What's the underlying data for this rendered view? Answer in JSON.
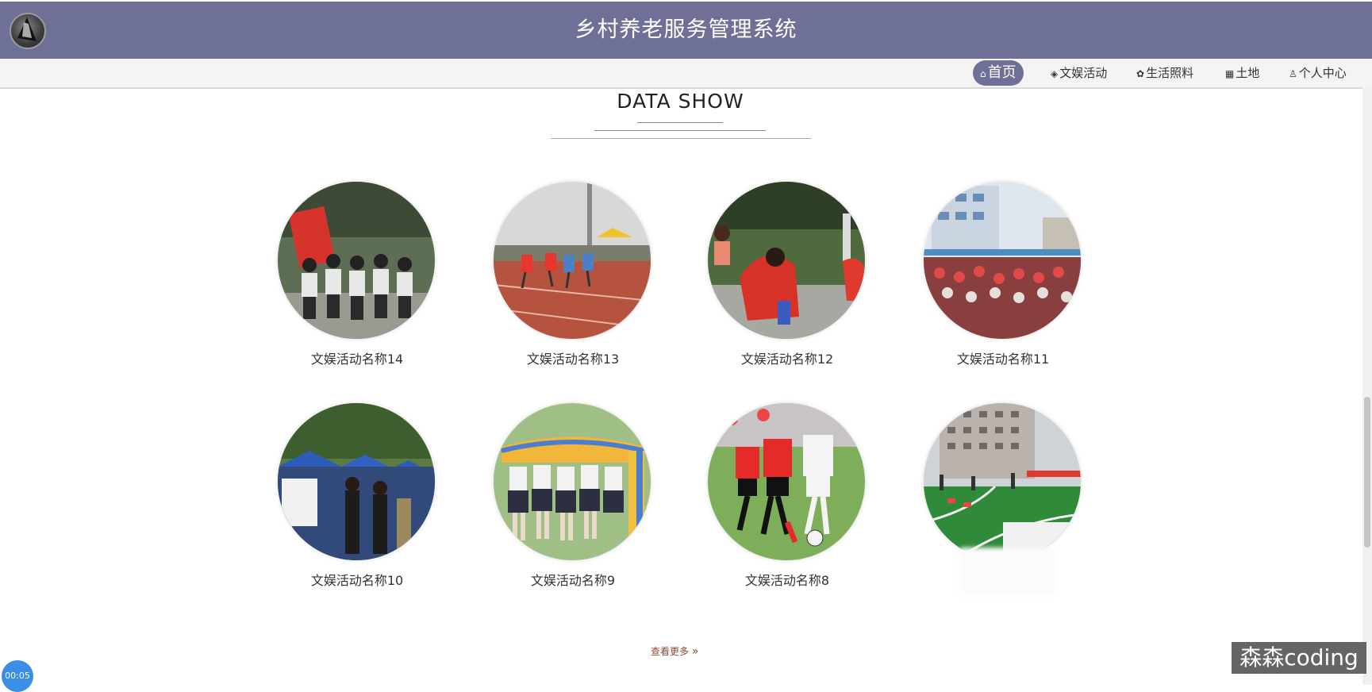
{
  "header": {
    "title": "乡村养老服务管理系统"
  },
  "nav": {
    "items": [
      {
        "label": "首页",
        "icon": "home-icon",
        "glyph": "⌂",
        "active": true
      },
      {
        "label": "文娱活动",
        "icon": "layers-icon",
        "glyph": "◈",
        "active": false
      },
      {
        "label": "生活照料",
        "icon": "palette-icon",
        "glyph": "✿",
        "active": false
      },
      {
        "label": "土地",
        "icon": "grid-icon",
        "glyph": "▦",
        "active": false
      },
      {
        "label": "个人中心",
        "icon": "user-icon",
        "glyph": "♙",
        "active": false
      }
    ]
  },
  "section": {
    "title": "DATA SHOW"
  },
  "activities": [
    {
      "name": "文娱活动名称14"
    },
    {
      "name": "文娱活动名称13"
    },
    {
      "name": "文娱活动名称12"
    },
    {
      "name": "文娱活动名称11"
    },
    {
      "name": "文娱活动名称10"
    },
    {
      "name": "文娱活动名称9"
    },
    {
      "name": "文娱活动名称8"
    },
    {
      "name": ""
    }
  ],
  "more": {
    "label": "查看更多",
    "glyph": "»"
  },
  "overlay": {
    "timer": "00:05",
    "watermark": "森森coding"
  },
  "colors": {
    "header": "#6e7097",
    "active_nav": "#6e7097",
    "more_link": "#8a4a2f"
  }
}
